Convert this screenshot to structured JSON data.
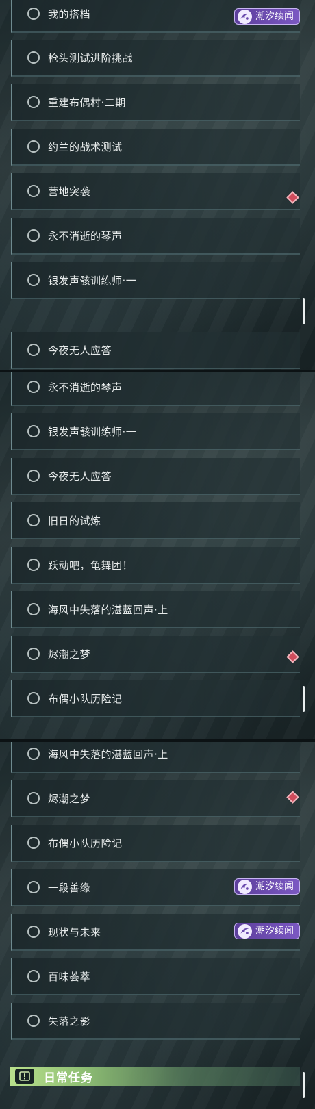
{
  "panel1": {
    "items": [
      {
        "label": "我的搭档"
      },
      {
        "label": "枪头测试进阶挑战"
      },
      {
        "label": "重建布偶村·二期"
      },
      {
        "label": "约兰的战术测试"
      },
      {
        "label": "营地突袭"
      },
      {
        "label": "永不消逝的琴声"
      },
      {
        "label": "银发声骸训练师·一"
      },
      {
        "label": "今夜无人应答"
      }
    ]
  },
  "panel2": {
    "items": [
      {
        "label": "永不消逝的琴声"
      },
      {
        "label": "银发声骸训练师·一"
      },
      {
        "label": "今夜无人应答"
      },
      {
        "label": "旧日的试炼"
      },
      {
        "label": "跃动吧，龟舞团！"
      },
      {
        "label": "海风中失落的湛蓝回声·上"
      },
      {
        "label": "烬潮之梦"
      },
      {
        "label": "布偶小队历险记"
      }
    ]
  },
  "panel3": {
    "items": [
      {
        "label": "海风中失落的湛蓝回声·上"
      },
      {
        "label": "烬潮之梦"
      },
      {
        "label": "布偶小队历险记"
      },
      {
        "label": "一段善缘"
      },
      {
        "label": "现状与未来"
      },
      {
        "label": "百味荟萃"
      },
      {
        "label": "失落之影"
      }
    ]
  },
  "badge": {
    "label": "潮汐续闻",
    "icon": "tide-swirl-icon",
    "color": "#6b4cae"
  },
  "alert": {
    "icon": "red-diamond-alert-icon",
    "color": "#cf4c5c"
  },
  "section": {
    "title": "日常任务",
    "icon": "exclamation-icon",
    "color": "#b9e08c"
  }
}
